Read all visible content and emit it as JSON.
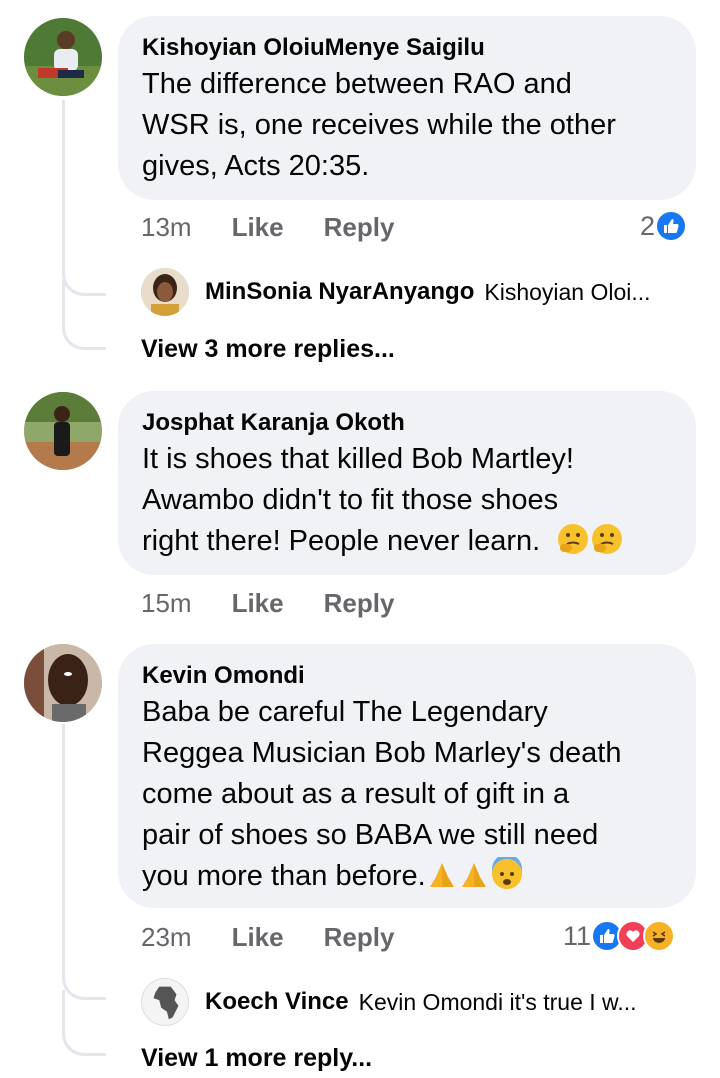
{
  "comments": [
    {
      "author": "Kishoyian OloiuMenye Saigilu",
      "lines": [
        "The difference between RAO and",
        "WSR is, one receives while the other",
        "gives, Acts 20:35."
      ],
      "time": "13m",
      "like": "Like",
      "reply": "Reply",
      "reaction_count": "2",
      "reactions": [
        "like"
      ],
      "replies": [
        {
          "author": "MinSonia NyarAnyango",
          "snippet": "Kishoyian Oloi..."
        }
      ],
      "view_more": "View 3 more replies..."
    },
    {
      "author": "Josphat Karanja Okoth",
      "lines": [
        "It is shoes that killed Bob Martley!",
        "Awambo didn't to fit those shoes",
        "right there! People never learn."
      ],
      "emoji_end": [
        "thinking-face",
        "thinking-face"
      ],
      "time": "15m",
      "like": "Like",
      "reply": "Reply"
    },
    {
      "author": "Kevin Omondi",
      "lines": [
        "Baba be careful The Legendary",
        "Reggea Musician Bob Marley's death",
        "come about as a result of gift in a",
        "pair of shoes so BABA we still need",
        "you more than before."
      ],
      "emoji_end": [
        "folded-hands",
        "folded-hands",
        "anxious-face"
      ],
      "time": "23m",
      "like": "Like",
      "reply": "Reply",
      "reaction_count": "11",
      "reactions": [
        "like",
        "love",
        "haha"
      ],
      "replies": [
        {
          "author": "Koech Vince",
          "snippet": "Kevin Omondi it's true I w..."
        }
      ],
      "view_more": "View 1 more reply..."
    }
  ]
}
